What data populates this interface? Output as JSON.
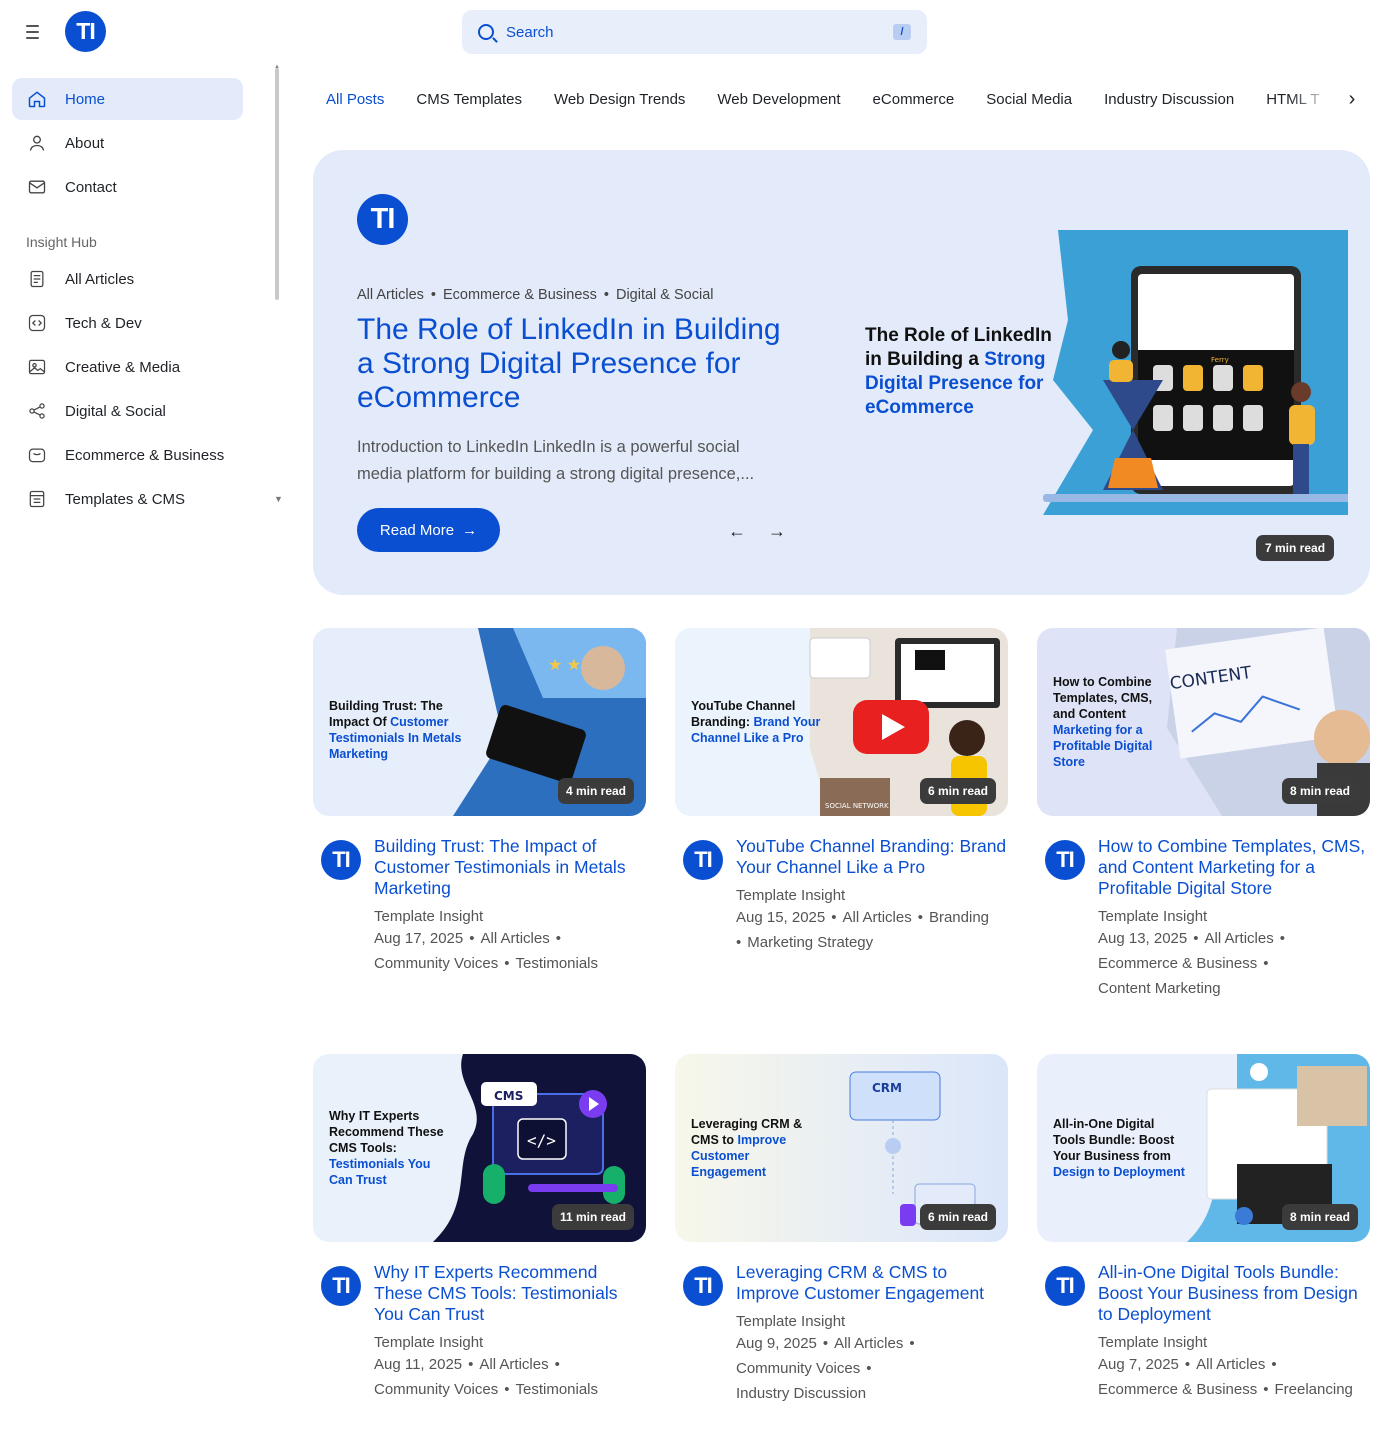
{
  "brand": {
    "logo_text": "TI"
  },
  "search": {
    "placeholder": "Search",
    "shortcut": "/"
  },
  "sidebar": {
    "main": [
      {
        "label": "Home",
        "icon": "home-icon"
      },
      {
        "label": "About",
        "icon": "user-icon"
      },
      {
        "label": "Contact",
        "icon": "mail-icon"
      }
    ],
    "section_label": "Insight Hub",
    "hub": [
      {
        "label": "All Articles",
        "icon": "articles-icon"
      },
      {
        "label": "Tech & Dev",
        "icon": "code-icon"
      },
      {
        "label": "Creative & Media",
        "icon": "image-icon"
      },
      {
        "label": "Digital & Social",
        "icon": "share-icon"
      },
      {
        "label": "Ecommerce & Business",
        "icon": "bag-icon"
      },
      {
        "label": "Templates & CMS",
        "icon": "template-icon"
      }
    ]
  },
  "tabs": [
    "All Posts",
    "CMS Templates",
    "Web Design Trends",
    "Web Development",
    "eCommerce",
    "Social Media",
    "Industry Discussion",
    "HTML T"
  ],
  "hero": {
    "categories": [
      "All Articles",
      "Ecommerce & Business",
      "Digital & Social"
    ],
    "title": "The Role of LinkedIn in Building a Strong Digital Presence for eCommerce",
    "excerpt": "Introduction to LinkedIn LinkedIn is a powerful social media platform for building a strong digital presence,...",
    "read_more": "Read More",
    "image_text_a": "The Role of LinkedIn in Building a",
    "image_text_b": "Strong Digital Presence for eCommerce",
    "read_time": "7 min read",
    "phone_label": "Ferry"
  },
  "cards": [
    {
      "thumb_text_a": "Building Trust: The Impact Of",
      "thumb_text_b": "Customer Testimonials In Metals Marketing",
      "read_time": "4 min read",
      "title": "Building Trust: The Impact of Customer Testimonials in Metals Marketing",
      "author": "Template Insight",
      "date": "Aug 17, 2025",
      "tags": [
        "All Articles",
        "Community Voices",
        "Testimonials"
      ]
    },
    {
      "thumb_text_a": "YouTube Channel Branding:",
      "thumb_text_b": "Brand Your Channel Like a Pro",
      "read_time": "6 min read",
      "title": "YouTube Channel Branding: Brand Your Channel Like a Pro",
      "author": "Template Insight",
      "date": "Aug 15, 2025",
      "tags": [
        "All Articles",
        "Branding",
        "Marketing Strategy"
      ],
      "thumb_label": "SOCIAL NETWORK"
    },
    {
      "thumb_text_a": "How to Combine Templates, CMS, and Content",
      "thumb_text_b": "Marketing for a Profitable Digital Store",
      "read_time": "8 min read",
      "title": "How to Combine Templates, CMS, and Content Marketing for a Profitable Digital Store",
      "author": "Template Insight",
      "date": "Aug 13, 2025",
      "tags": [
        "All Articles",
        "Ecommerce & Business",
        "Content Marketing"
      ],
      "thumb_label": "CONTENT"
    },
    {
      "thumb_text_a": "Why IT Experts Recommend These CMS Tools:",
      "thumb_text_b": "Testimonials You Can Trust",
      "read_time": "11 min read",
      "title": "Why IT Experts Recommend These CMS Tools: Testimonials You Can Trust",
      "author": "Template Insight",
      "date": "Aug 11, 2025",
      "tags": [
        "All Articles",
        "Community Voices",
        "Testimonials"
      ],
      "thumb_label": "CMS"
    },
    {
      "thumb_text_a": "Leveraging CRM & CMS to",
      "thumb_text_b": "Improve Customer Engagement",
      "read_time": "6 min read",
      "title": "Leveraging CRM & CMS to Improve Customer Engagement",
      "author": "Template Insight",
      "date": "Aug 9, 2025",
      "tags": [
        "All Articles",
        "Community Voices",
        "Industry Discussion"
      ],
      "thumb_label": "CRM"
    },
    {
      "thumb_text_a": "All-in-One Digital Tools Bundle: Boost Your Business from",
      "thumb_text_b": "Design to Deployment",
      "read_time": "8 min read",
      "title": "All-in-One Digital Tools Bundle: Boost Your Business from Design to Deployment",
      "author": "Template Insight",
      "date": "Aug 7, 2025",
      "tags": [
        "All Articles",
        "Ecommerce & Business",
        "Freelancing"
      ]
    }
  ],
  "colors": {
    "accent": "#0a4fd1",
    "hero_bg": "#e3ebfa",
    "badge_bg": "#3b3b3b"
  }
}
